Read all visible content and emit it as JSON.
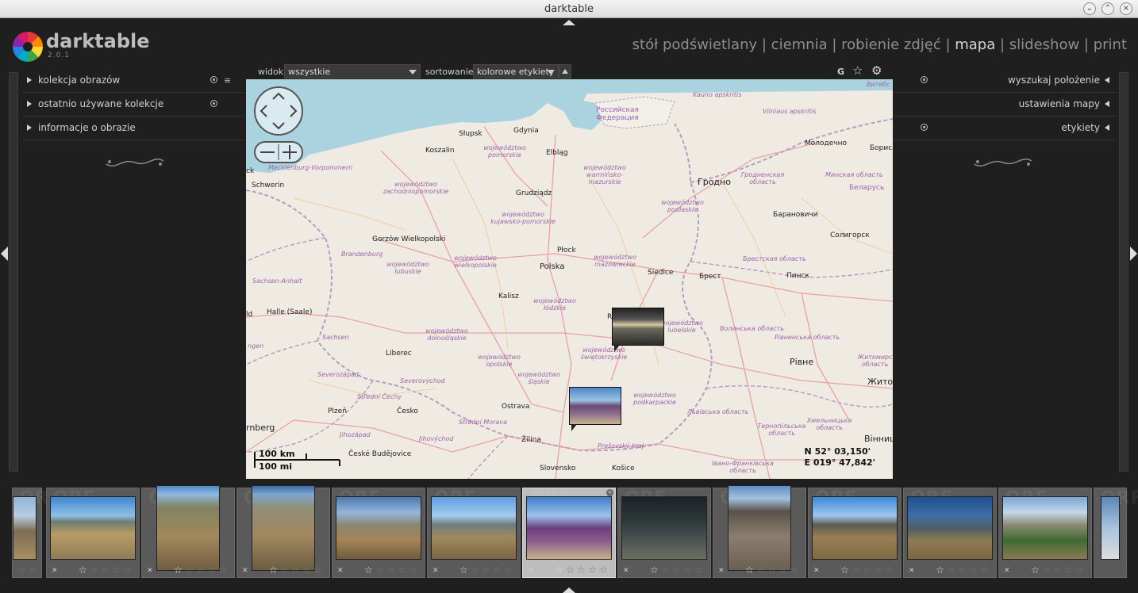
{
  "window": {
    "title": "darktable"
  },
  "brand": {
    "name": "darktable",
    "version": "2.0.1"
  },
  "views": [
    {
      "label": "stół podświetlany",
      "active": false
    },
    {
      "label": "ciemnia",
      "active": false
    },
    {
      "label": "robienie zdjęć",
      "active": false
    },
    {
      "label": "mapa",
      "active": true
    },
    {
      "label": "slideshow",
      "active": false
    },
    {
      "label": "print",
      "active": false
    }
  ],
  "left_panel": {
    "modules": [
      {
        "label": "kolekcja obrazów"
      },
      {
        "label": "ostatnio używane kolekcje"
      },
      {
        "label": "informacje o obrazie"
      }
    ]
  },
  "right_panel": {
    "modules": [
      {
        "label": "wyszukaj położenie"
      },
      {
        "label": "ustawienia mapy"
      },
      {
        "label": "etykiety"
      }
    ]
  },
  "toolbar": {
    "view_label": "widok",
    "view_value": "wszystkie",
    "sort_label": "sortowanie",
    "sort_value": "kolorowe etykiety",
    "grouping_label": "G"
  },
  "map": {
    "cities": [
      {
        "name": "Słupsk"
      },
      {
        "name": "Gdynia"
      },
      {
        "name": "Koszalin"
      },
      {
        "name": "Elbląg"
      },
      {
        "name": "Schwerin"
      },
      {
        "name": "Grudziądz"
      },
      {
        "name": "Gorzów Wielkopolski"
      },
      {
        "name": "Płock"
      },
      {
        "name": "Polska"
      },
      {
        "name": "Siedlce"
      },
      {
        "name": "Kalisz"
      },
      {
        "name": "Halle (Saale)"
      },
      {
        "name": "Liberec"
      },
      {
        "name": "Plzeň"
      },
      {
        "name": "Česko"
      },
      {
        "name": "Ostrava"
      },
      {
        "name": "Žilina"
      },
      {
        "name": "České Budějovice"
      },
      {
        "name": "Slovensko"
      },
      {
        "name": "Košice"
      },
      {
        "name": "Гродно"
      },
      {
        "name": "Молодечно"
      },
      {
        "name": "Борисо"
      },
      {
        "name": "Барановичи"
      },
      {
        "name": "Солигорск"
      },
      {
        "name": "Брест"
      },
      {
        "name": "Пинск"
      },
      {
        "name": "Рівне"
      },
      {
        "name": "Житом"
      },
      {
        "name": "Вінниц"
      },
      {
        "name": "rnberg"
      },
      {
        "name": "R"
      }
    ],
    "regions": [
      {
        "name": "województwo pomorskie"
      },
      {
        "name": "województwo warmińsko-mazurskie"
      },
      {
        "name": "województwo zachodniopomorskie"
      },
      {
        "name": "województwo podlaskie"
      },
      {
        "name": "województwo kujawsko-pomorskie"
      },
      {
        "name": "województwo wielkopolskie"
      },
      {
        "name": "województwo lubuskie"
      },
      {
        "name": "województwo mazowieckie"
      },
      {
        "name": "województwo łódzkie"
      },
      {
        "name": "województwo lubelskie"
      },
      {
        "name": "województwo dolnośląskie"
      },
      {
        "name": "województwo świętokrzyskie"
      },
      {
        "name": "województwo opolskie"
      },
      {
        "name": "województwo śląskie"
      },
      {
        "name": "województwo podkarpackie"
      },
      {
        "name": "Mecklenburg-Vorpommern"
      },
      {
        "name": "Brandenburg"
      },
      {
        "name": "Sachsen-Anhalt"
      },
      {
        "name": "Sachsen"
      },
      {
        "name": "Severozápad"
      },
      {
        "name": "Severovýchod"
      },
      {
        "name": "Střední Čechy"
      },
      {
        "name": "Jihozápad"
      },
      {
        "name": "Jihovýchod"
      },
      {
        "name": "Střední Morava"
      },
      {
        "name": "Prešovský kraj"
      },
      {
        "name": "Российская Федерация"
      },
      {
        "name": "Kauno apskritis"
      },
      {
        "name": "Vilniaus apskritis"
      },
      {
        "name": "Витебс"
      },
      {
        "name": "Гродненская область"
      },
      {
        "name": "Минская область"
      },
      {
        "name": "Беларусь"
      },
      {
        "name": "Брестская область"
      },
      {
        "name": "Волинська область"
      },
      {
        "name": "Рівненська область"
      },
      {
        "name": "Львівська область"
      },
      {
        "name": "Тернопільська область"
      },
      {
        "name": "Хмельницька область"
      },
      {
        "name": "Житомирс область"
      },
      {
        "name": "Івано-Франківська область"
      },
      {
        "name": "ngen"
      },
      {
        "name": "ck"
      },
      {
        "name": "ld"
      }
    ],
    "scale_km": "100 km",
    "scale_mi": "100 mi",
    "lat": "N 52° 03,150'",
    "lon": "E 019° 47,842'"
  },
  "filmstrip": {
    "watermark": "ORF",
    "thumbs": [
      {
        "rating": 0,
        "selected": false
      },
      {
        "rating": 1,
        "selected": false
      },
      {
        "rating": 1,
        "selected": false
      },
      {
        "rating": 1,
        "selected": false
      },
      {
        "rating": 1,
        "selected": false
      },
      {
        "rating": 1,
        "selected": false
      },
      {
        "rating": 1,
        "selected": true
      },
      {
        "rating": 1,
        "selected": false
      },
      {
        "rating": 1,
        "selected": false
      },
      {
        "rating": 1,
        "selected": false
      },
      {
        "rating": 1,
        "selected": false
      },
      {
        "rating": 1,
        "selected": false
      },
      {
        "rating": 0,
        "selected": false
      }
    ]
  }
}
